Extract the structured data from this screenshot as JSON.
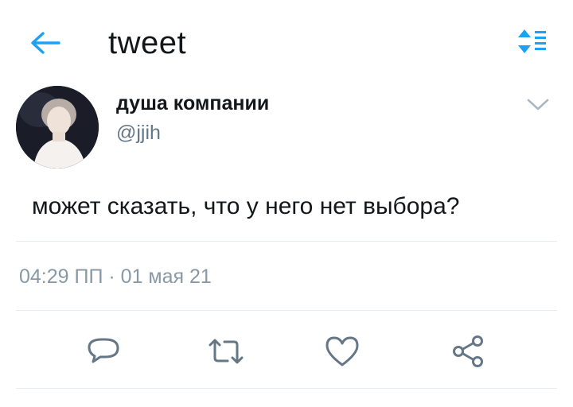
{
  "header": {
    "title": "tweet",
    "back_icon": "arrow-left-icon",
    "sort_icon": "sort-icon",
    "accent_color": "#1da1f2"
  },
  "tweet": {
    "author": {
      "display_name": "душа компании",
      "handle": "@jjih",
      "avatar": "avatar"
    },
    "text": "может сказать, что у него нет выбора?",
    "timestamp": "04:29 ПП · 01 мая 21",
    "menu_icon": "chevron-down-icon"
  },
  "actions": [
    {
      "name": "reply",
      "icon": "reply-icon"
    },
    {
      "name": "retweet",
      "icon": "retweet-icon"
    },
    {
      "name": "like",
      "icon": "heart-icon"
    },
    {
      "name": "share",
      "icon": "share-icon"
    }
  ],
  "colors": {
    "text_primary": "#14171a",
    "text_secondary": "#657786",
    "icon_gray": "#657786",
    "divider": "#e6ecf0"
  }
}
